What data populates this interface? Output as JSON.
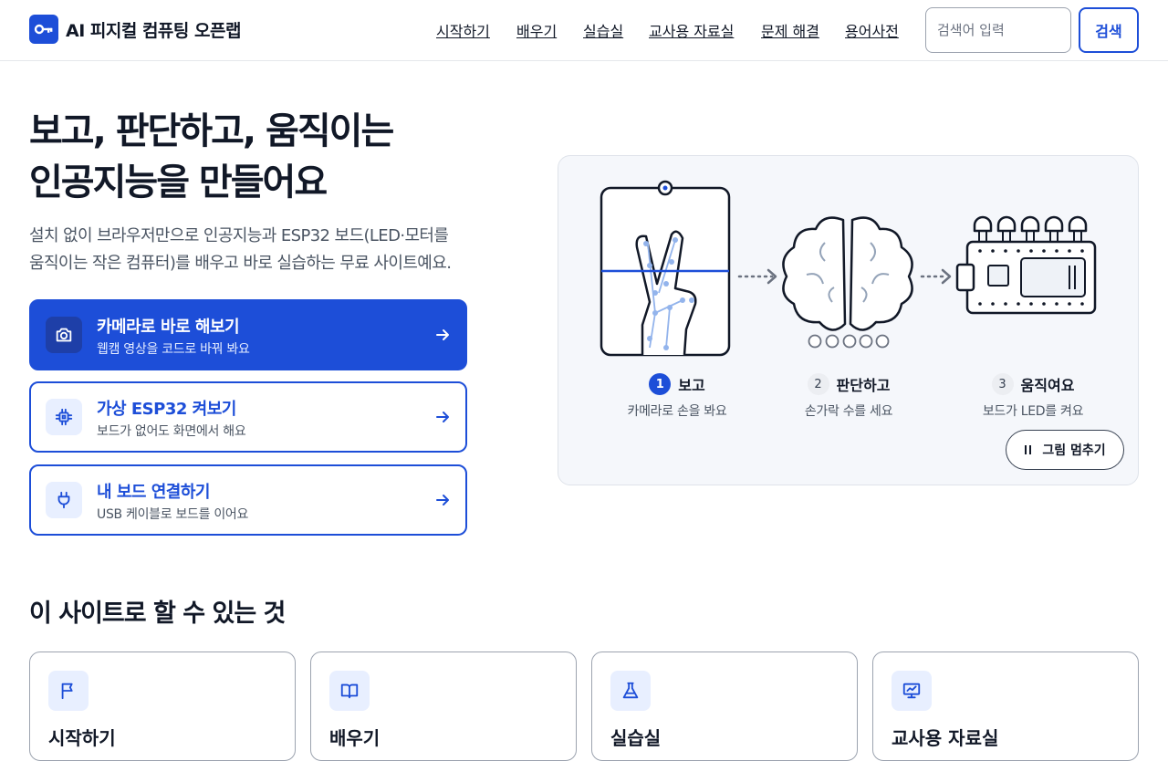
{
  "header": {
    "logo_text": "AI 피지컬 컴퓨팅 오픈랩",
    "nav": [
      "시작하기",
      "배우기",
      "실습실",
      "교사용 자료실",
      "문제 해결",
      "용어사전"
    ],
    "search_placeholder": "검색어 입력",
    "search_button": "검색"
  },
  "hero": {
    "title_line1": "보고, 판단하고, 움직이는",
    "title_line2": "인공지능을 만들어요",
    "desc_line1": "설치 없이 브라우저만으로 인공지능과 ESP32 보드(LED·모터를",
    "desc_line2": "움직이는 작은 컴퓨터)를 배우고 바로 실습하는 무료 사이트예요.",
    "actions": [
      {
        "title": "카메라로 바로 해보기",
        "subtitle": "웹캠 영상을 코드로 바꿔 봐요",
        "icon": "camera-icon"
      },
      {
        "title": "가상 ESP32 켜보기",
        "subtitle": "보드가 없어도 화면에서 해요",
        "icon": "chip-icon"
      },
      {
        "title": "내 보드 연결하기",
        "subtitle": "USB 케이블로 보드를 이어요",
        "icon": "plug-icon"
      }
    ]
  },
  "illustration": {
    "steps": [
      {
        "num": "1",
        "label": "보고",
        "sub": "카메라로 손을 봐요",
        "active": true
      },
      {
        "num": "2",
        "label": "판단하고",
        "sub": "손가락 수를 세요",
        "active": false
      },
      {
        "num": "3",
        "label": "움직여요",
        "sub": "보드가 LED를 켜요",
        "active": false
      }
    ],
    "pause_label": "그림 멈추기"
  },
  "features": {
    "title": "이 사이트로 할 수 있는 것",
    "cards": [
      {
        "title": "시작하기",
        "icon": "flag-icon"
      },
      {
        "title": "배우기",
        "icon": "book-icon"
      },
      {
        "title": "실습실",
        "icon": "flask-icon"
      },
      {
        "title": "교사용 자료실",
        "icon": "presentation-icon"
      }
    ]
  },
  "colors": {
    "primary": "#1d4ed8",
    "text": "#111827",
    "muted": "#4b5563",
    "panel": "#f5f7fb"
  }
}
